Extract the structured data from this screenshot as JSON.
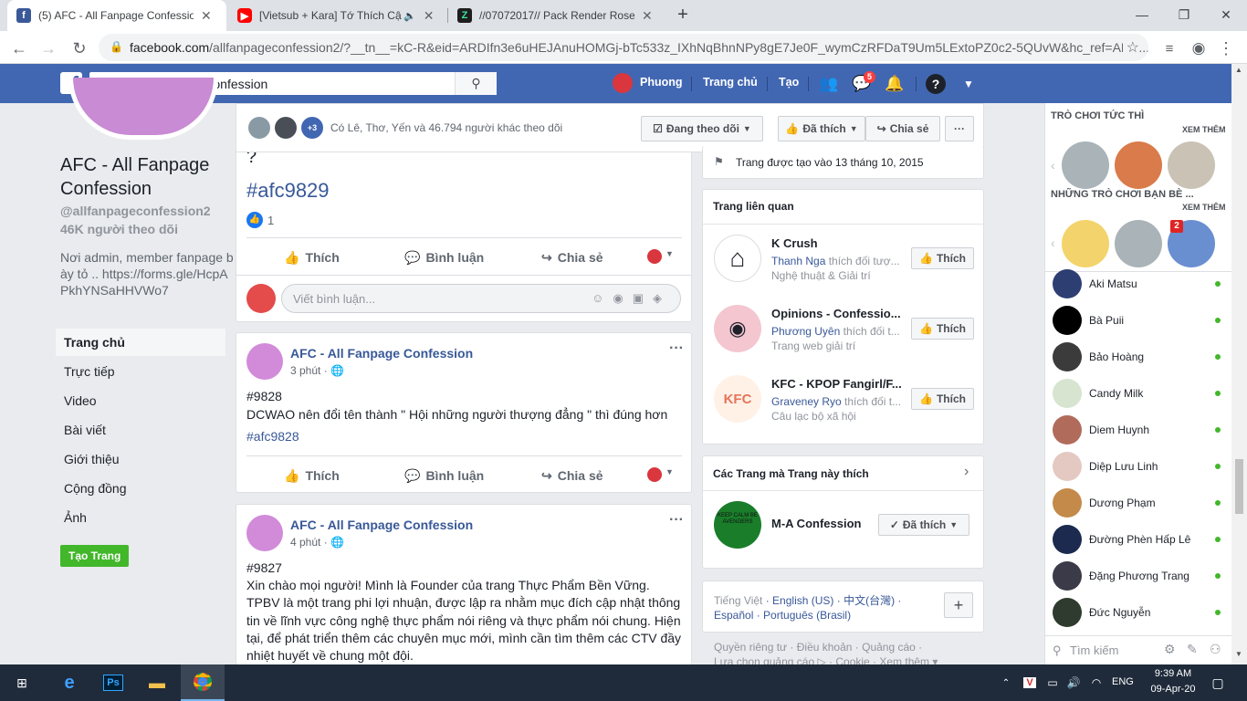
{
  "browser": {
    "tabs": [
      {
        "title": "(5) AFC - All Fanpage Confession",
        "favicon": "facebook-icon",
        "active": true
      },
      {
        "title": "[Vietsub + Kara] Tớ Thích Cậ",
        "favicon": "youtube-icon",
        "active": false
      },
      {
        "title": "//07072017// Pack Render Rose",
        "favicon": "page-icon",
        "active": false
      }
    ],
    "new_tab": "+",
    "url_host": "facebook.com",
    "url_rest": "/allfanpageconfession2/?__tn__=kC-R&eid=ARDIfn3e6uHEJAnuHOMGj-bTc533z_IXhNqBhnNPy8gE7Je0F_wymCzRFDaT9Um5LExtoPZ0c2-5QUvW&hc_ref=ARS..."
  },
  "fbbar": {
    "search_value": "AFC - All Fanpage Confession",
    "profile_name": "Phuong",
    "home": "Trang chủ",
    "create": "Tạo",
    "messenger_badge": "5",
    "color": "#4267b2"
  },
  "page": {
    "name": "AFC - All Fanpage Confession",
    "handle": "@allfanpageconfession2",
    "followers": "46K người theo dõi",
    "bio": "Nơi admin, member fanpage bày tỏ .. https://forms.gle/HcpAPkhYNSaHHVWo7",
    "nav": [
      "Trang chủ",
      "Trực tiếp",
      "Video",
      "Bài viết",
      "Giới thiệu",
      "Cộng đồng",
      "Ảnh"
    ],
    "create_page": "Tạo Trang"
  },
  "followbar": {
    "text": "Có Lê, Thơ, Yến và 46.794 người khác theo dõi",
    "plus": "+3",
    "following": "Đang theo dõi",
    "liked": "Đã thích",
    "share": "Chia sẻ",
    "more": "···"
  },
  "post1": {
    "tail_char": "?",
    "hashtag": "#afc9829",
    "likes": "1",
    "like": "Thích",
    "comment": "Bình luận",
    "share": "Chia sẻ",
    "comment_placeholder": "Viết bình luận..."
  },
  "post2": {
    "author": "AFC - All Fanpage Confession",
    "time": "3 phút",
    "id": "#9828",
    "text": "DCWAO nên đổi tên thành \" Hội những người thượng đẳng \" thì đúng hơn",
    "hashtag": "#afc9828",
    "like": "Thích",
    "comment": "Bình luận",
    "share": "Chia sẻ"
  },
  "post3": {
    "author": "AFC - All Fanpage Confession",
    "time": "4 phút",
    "id": "#9827",
    "text": "Xin chào mọi người! Mình là Founder của trang Thực Phẩm Bền Vững. TPBV là một trang phi lợi nhuận, được lập ra nhằm mục đích cập nhật thông tin về lĩnh vực công nghệ thực phẩm nói riêng và thực phẩm nói chung. Hiện tại, để phát triển thêm các chuyên mục mới, mình cần tìm thêm các CTV đầy nhiệt huyết về chung một đội."
  },
  "right": {
    "created": "Trang được tạo vào 13 tháng 10, 2015",
    "related_title": "Trang liên quan",
    "related": [
      {
        "name": "K Crush",
        "friend": "Thanh Nga",
        "friend_rest": " thích đối tượ...",
        "category": "Nghệ thuật & Giải trí",
        "like": "Thích"
      },
      {
        "name": "Opinions - Confessio...",
        "friend": "Phương Uyên",
        "friend_rest": " thích đối t...",
        "category": "Trang web giải trí",
        "like": "Thích"
      },
      {
        "name": "KFC - KPOP Fangirl/F...",
        "friend": "Graveney Ryo",
        "friend_rest": " thích đối t...",
        "category": "Câu lạc bộ xã hội",
        "like": "Thích"
      }
    ],
    "liked_title": "Các Trang mà Trang này thích",
    "liked_page": "M-A Confession",
    "liked_btn": "Đã thích",
    "kfc_logo_text": "KFC",
    "ma_logo_text": "KEEP CALM BE AVENGERS",
    "languages": [
      "Tiếng Việt",
      "English (US)",
      "中文(台灣)",
      "Español",
      "Português (Brasil)"
    ],
    "add_lang": "+",
    "footer1": "Quyền riêng tư · Điều khoản · Quảng cáo ·",
    "footer2": "Lựa chọn quảng cáo ▷ · Cookie · Xem thêm ▾"
  },
  "chat": {
    "games_title": "TRÒ CHƠI TỨC THÌ",
    "see_more": "XEM THÊM",
    "friends_games_title": "NHỮNG TRÒ CHƠI BẠN BÈ ...",
    "game_badge": "2",
    "contacts": [
      "Aki Matsu",
      "Bà Puii",
      "Bảo Hoàng",
      "Candy Milk",
      "Diem Huynh",
      "Diệp Lưu Linh",
      "Dương Phạm",
      "Đường Phèn Hấp Lê",
      "Đặng Phương Trang",
      "Đức Nguyễn"
    ],
    "search_placeholder": "Tìm kiếm"
  },
  "taskbar": {
    "time": "9:39 AM",
    "date": "09-Apr-20",
    "lang": "ENG"
  }
}
